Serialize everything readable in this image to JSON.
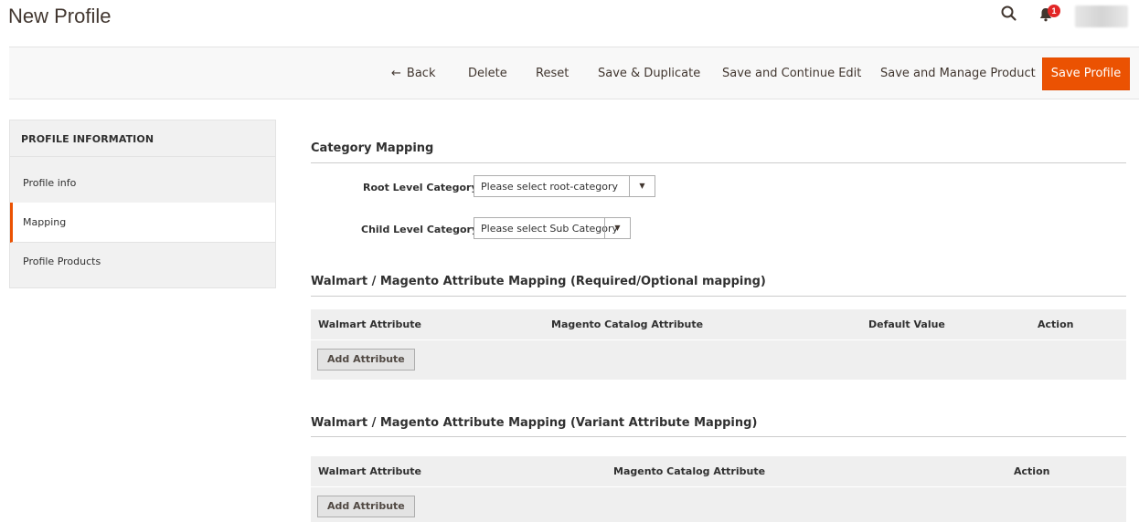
{
  "header": {
    "title": "New Profile",
    "notifications_count": "1",
    "search_icon": "search-icon",
    "bell_icon": "bell-icon"
  },
  "toolbar": {
    "back_label": "Back",
    "back_icon": "arrow-left-icon",
    "delete_label": "Delete",
    "reset_label": "Reset",
    "save_duplicate_label": "Save & Duplicate",
    "save_continue_label": "Save and Continue Edit",
    "save_manage_label": "Save and Manage Product",
    "save_profile_label": "Save Profile"
  },
  "sidebar": {
    "title": "PROFILE INFORMATION",
    "items": [
      {
        "label": "Profile info",
        "active": false
      },
      {
        "label": "Mapping",
        "active": true
      },
      {
        "label": "Profile Products",
        "active": false
      }
    ]
  },
  "category_mapping": {
    "title": "Category Mapping",
    "root_label": "Root Level Category",
    "root_value": "Please select root-category",
    "child_label": "Child Level Category",
    "child_value": "Please select Sub Category",
    "required_mark": "*"
  },
  "attribute_mapping": {
    "title": "Walmart / Magento Attribute Mapping (Required/Optional mapping)",
    "columns": [
      "Walmart Attribute",
      "Magento Catalog Attribute",
      "Default Value",
      "Action"
    ],
    "add_label": "Add Attribute"
  },
  "variant_mapping": {
    "title": "Walmart / Magento Attribute Mapping (Variant Attribute Mapping)",
    "columns": [
      "Walmart Attribute",
      "Magento Catalog Attribute",
      "Action"
    ],
    "add_label": "Add Attribute"
  },
  "colors": {
    "accent": "#eb5202",
    "required": "#e22626",
    "badge": "#e22626"
  }
}
